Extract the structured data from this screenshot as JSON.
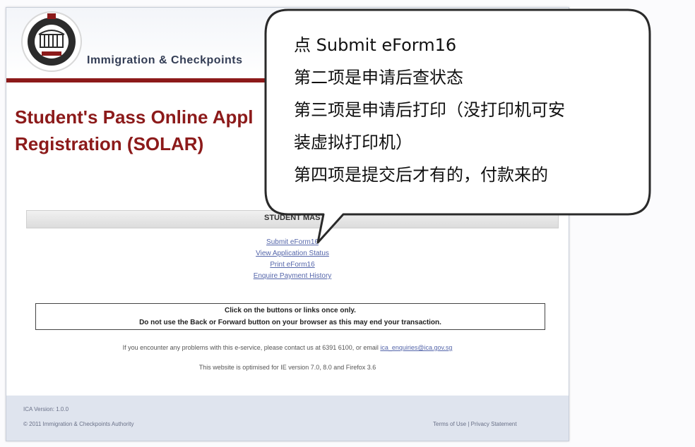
{
  "header": {
    "agency_name": "Immigration & Checkpoints"
  },
  "title": {
    "line1": "Student's Pass Online Appl",
    "line2": "Registration (SOLAR)"
  },
  "menu": {
    "bar_title": "STUDENT MAST",
    "links": [
      "Submit eForm16",
      "View Application Status",
      "Print eForm16",
      "Enquire Payment History"
    ]
  },
  "notice": {
    "line1": "Click on the buttons or links once only.",
    "line2": "Do not use the Back or Forward button on your browser as this may end your transaction."
  },
  "contact": {
    "text": "If you encounter any problems with this e-service, please contact us at 6391 6100, or email",
    "email": "ica_enquiries@ica.gov.sg"
  },
  "optimized": "This website is optimised for IE version 7.0, 8.0 and Firefox 3.6",
  "footer": {
    "version": "ICA Version: 1.0.0",
    "copyright": "© 2011 Immigration & Checkpoints Authority",
    "terms": "Terms of Use",
    "separator": "|",
    "privacy": "Privacy Statement"
  },
  "bubble": {
    "lines": [
      "点 Submit eForm16",
      "第二项是申请后查状态",
      "第三项是申请后打印（没打印机可安",
      "装虚拟打印机）",
      "第四项是提交后才有的，付款来的"
    ]
  },
  "colors": {
    "brand_red": "#8c1a1a",
    "link": "#5566aa",
    "footer_bg": "#dfe4ee"
  }
}
